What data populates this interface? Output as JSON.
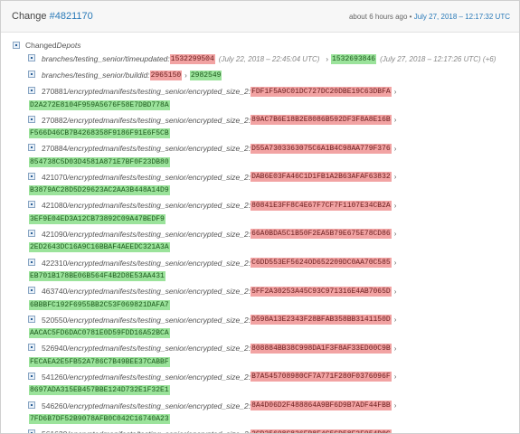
{
  "header": {
    "title_prefix": "Change ",
    "change_number": "#4821170",
    "relative_time": "about 6 hours ago",
    "separator": " • ",
    "date": "July 27, 2018 – 12:17:32 UTC"
  },
  "section": {
    "label": "Changed ",
    "label_italic": "Depots"
  },
  "entries": [
    {
      "path": "branches/testing_senior/timeupdated:",
      "old": "1532299504",
      "old_note": "(July 22, 2018 – 22:45:04 UTC)",
      "arrow": "›",
      "new": "1532693846",
      "new_note": "(July 27, 2018 – 12:17:26 UTC) (+6)"
    },
    {
      "path": "branches/testing_senior/buildid:",
      "old": "2965150",
      "arrow": "›",
      "new": "2982549"
    },
    {
      "depot": "270881",
      "path": "/encryptedmanifests/testing_senior/encrypted_size_2:",
      "old": "FDF1F5A9C01DC727DC20DBE19C63DBFA",
      "arrow": "›",
      "new": "D2A272E8104F959A5676F58E7DBD778A"
    },
    {
      "depot": "270882",
      "path": "/encryptedmanifests/testing_senior/encrypted_size_2:",
      "old": "89AC7B6E18B2E8086B592DF3F8A8E16B",
      "arrow": "›",
      "new": "F566D46CB7B4268358F9186F91E6F5CB"
    },
    {
      "depot": "270884",
      "path": "/encryptedmanifests/testing_senior/encrypted_size_2:",
      "old": "D55A7303363075C6A1B4C98AA779F376",
      "arrow": "›",
      "new": "854738C5D03D4581A871E7BF0F23DB80"
    },
    {
      "depot": "421070",
      "path": "/encryptedmanifests/testing_senior/encrypted_size_2:",
      "old": "DAB6E03FA46C1D1FB1A2B63AFAF63832",
      "arrow": "›",
      "new": "B3879AC28D5D29623AC2AA3B448A14D9"
    },
    {
      "depot": "421080",
      "path": "/encryptedmanifests/testing_senior/encrypted_size_2:",
      "old": "80841E3FF8C4E67F7CF7F1107E34CB2A",
      "arrow": "›",
      "new": "3EF9E04ED3A12CB73892C09A47BEDF9"
    },
    {
      "depot": "421090",
      "path": "/encryptedmanifests/testing_senior/encrypted_size_2:",
      "old": "66A0BDA5C1B50F2EA5B79E675E78CD86",
      "arrow": "›",
      "new": "2ED2643DC16A9C16BBAF4AEEDC321A3A"
    },
    {
      "depot": "422310",
      "path": "/encryptedmanifests/testing_senior/encrypted_size_2:",
      "old": "C6DD553EF5624OD652209DC0AA70C585",
      "arrow": "›",
      "new": "EB701B178BE06B564F4B2D8E53AA431"
    },
    {
      "depot": "463740",
      "path": "/encryptedmanifests/testing_senior/encrypted_size_2:",
      "old": "5FF2A30253A45C93C971316E4AB7065D",
      "arrow": "›",
      "new": "6BBBFC192F6955BB2C53F069821DAFA7"
    },
    {
      "depot": "520550",
      "path": "/encryptedmanifests/testing_senior/encrypted_size_2:",
      "old": "D598A13E2343F28BFAB358BB3141150D",
      "arrow": "›",
      "new": "AACAC5FD6DAC0781E0D59FDD16A52BCA"
    },
    {
      "depot": "526940",
      "path": "/encryptedmanifests/testing_senior/encrypted_size_2:",
      "old": "808884BB38C998DA1F3F8AF33ED00C9B",
      "arrow": "›",
      "new": "FECAEA2E5FB52A786C7B49BEE37CABBF"
    },
    {
      "depot": "541260",
      "path": "/encryptedmanifests/testing_senior/encrypted_size_2:",
      "old": "B7A545708980CF7A771F280F0376096F",
      "arrow": "›",
      "new": "8697ADA315EB457BBE124D732E1F32E1"
    },
    {
      "depot": "546260",
      "path": "/encryptedmanifests/testing_senior/encrypted_size_2:",
      "old": "8A4D06D2F488864A9BF6D9B7ADF44FBB",
      "arrow": "›",
      "new": "7FD6B7DF52B9078AFB0C042C16740A23"
    },
    {
      "depot": "561620",
      "path": "/encryptedmanifests/testing_senior/encrypted_size_2:",
      "old": "2CD25698C836EB8E4C5CD58F2F954D0C",
      "arrow": "›",
      "new": ""
    }
  ]
}
